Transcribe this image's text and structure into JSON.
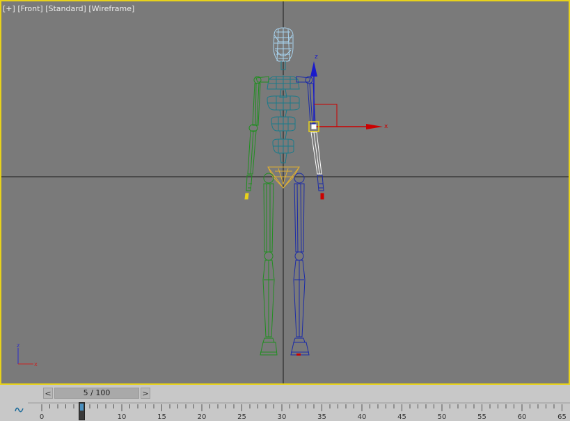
{
  "viewport": {
    "labels": [
      "[+]",
      "[Front]",
      "[Standard]",
      "[Wireframe]"
    ],
    "active_border_color": "#e8d21a",
    "background_color": "#7a7a7a"
  },
  "gizmo": {
    "x_label": "x",
    "z_label": "z",
    "x_color": "#cc0000",
    "z_color": "#1a1acc"
  },
  "axis_tripod": {
    "x_label": "x",
    "z_label": "z"
  },
  "skeleton": {
    "left_color": "#1f8f1f",
    "right_color": "#1a2aa8",
    "spine_color": "#1a7a8a",
    "head_color": "#a8d4f0",
    "pelvis_color": "#e0b030",
    "selected_color": "#ffffff"
  },
  "timeline": {
    "prev_label": "<",
    "next_label": ">",
    "frame_display": "5 / 100",
    "current_frame": 5,
    "total_frames": 100,
    "tick_labels": [
      "0",
      "5",
      "10",
      "15",
      "20",
      "25",
      "30",
      "35",
      "40",
      "45",
      "50",
      "55",
      "60",
      "65"
    ],
    "curve_icon": "function-curve-icon"
  }
}
